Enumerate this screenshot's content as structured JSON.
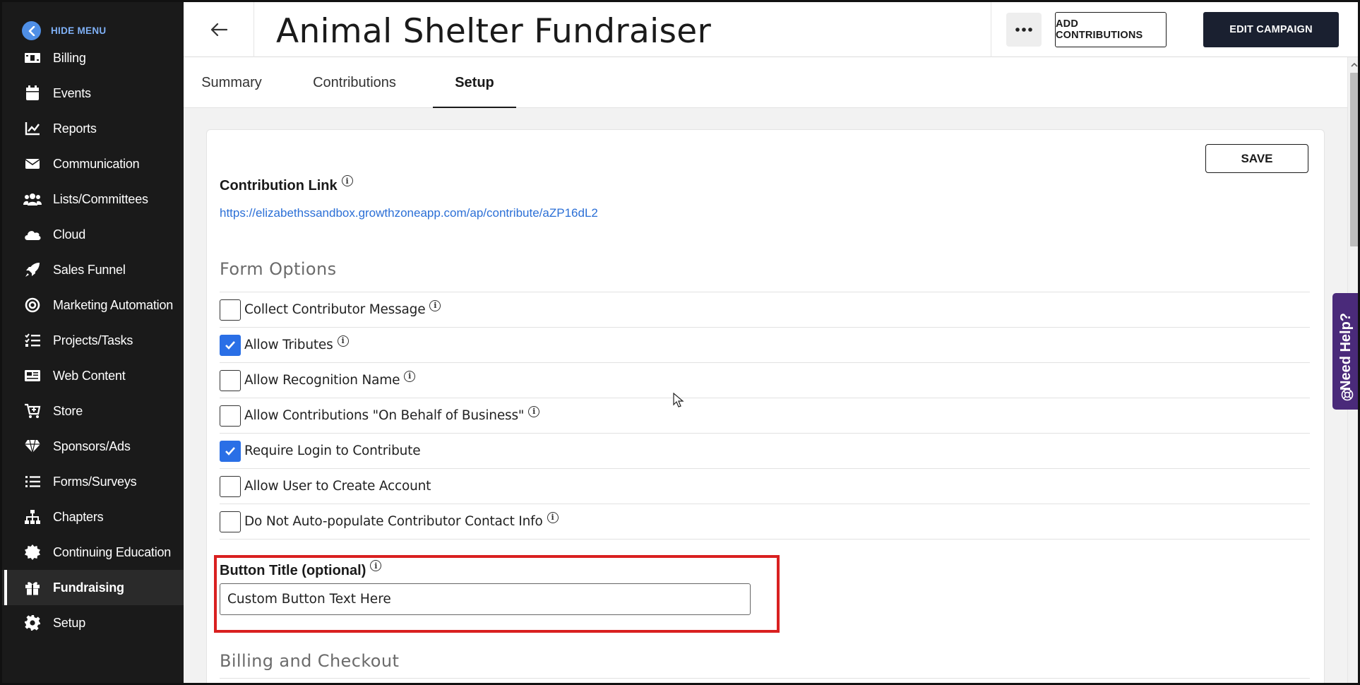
{
  "sidebar": {
    "hide_menu": "HIDE MENU",
    "items": [
      {
        "label": "Billing",
        "icon": "billing-icon"
      },
      {
        "label": "Events",
        "icon": "calendar-icon"
      },
      {
        "label": "Reports",
        "icon": "chart-icon"
      },
      {
        "label": "Communication",
        "icon": "envelope-icon"
      },
      {
        "label": "Lists/Committees",
        "icon": "users-icon"
      },
      {
        "label": "Cloud",
        "icon": "cloud-icon"
      },
      {
        "label": "Sales Funnel",
        "icon": "rocket-icon"
      },
      {
        "label": "Marketing Automation",
        "icon": "target-icon"
      },
      {
        "label": "Projects/Tasks",
        "icon": "tasks-icon"
      },
      {
        "label": "Web Content",
        "icon": "newspaper-icon"
      },
      {
        "label": "Store",
        "icon": "cart-icon"
      },
      {
        "label": "Sponsors/Ads",
        "icon": "gem-icon"
      },
      {
        "label": "Forms/Surveys",
        "icon": "list-icon"
      },
      {
        "label": "Chapters",
        "icon": "sitemap-icon"
      },
      {
        "label": "Continuing Education",
        "icon": "badge-icon"
      },
      {
        "label": "Fundraising",
        "icon": "gift-icon",
        "active": true
      },
      {
        "label": "Setup",
        "icon": "gear-icon"
      }
    ]
  },
  "header": {
    "title": "Animal Shelter Fundraiser",
    "add_contributions": "ADD CONTRIBUTIONS",
    "edit_campaign": "EDIT CAMPAIGN"
  },
  "tabs": [
    {
      "label": "Summary"
    },
    {
      "label": "Contributions"
    },
    {
      "label": "Setup",
      "active": true
    }
  ],
  "setup": {
    "save_label": "SAVE",
    "contribution_link_title": "Contribution Link",
    "contribution_link": "https://elizabethssandbox.growthzoneapp.com/ap/contribute/aZP16dL2",
    "form_options_title": "Form Options",
    "options": [
      {
        "label": "Collect Contributor Message",
        "checked": false,
        "info": true
      },
      {
        "label": "Allow Tributes",
        "checked": true,
        "info": true
      },
      {
        "label": "Allow Recognition Name",
        "checked": false,
        "info": true
      },
      {
        "label": "Allow Contributions \"On Behalf of Business\"",
        "checked": false,
        "info": true
      },
      {
        "label": "Require Login to Contribute",
        "checked": true,
        "info": false
      },
      {
        "label": "Allow User to Create Account",
        "checked": false,
        "info": false
      },
      {
        "label": "Do Not Auto-populate Contributor Contact Info",
        "checked": false,
        "info": true
      }
    ],
    "button_title_label": "Button Title (optional)",
    "button_title_value": "Custom Button Text Here",
    "billing_title": "Billing and Checkout"
  },
  "help": {
    "label": "Need Help?"
  },
  "colors": {
    "sidebar_bg": "#1a1a1a",
    "accent": "#2a6fe6",
    "link": "#2b6fd6",
    "highlight": "#d92020",
    "help_bg": "#4a2a7a"
  }
}
